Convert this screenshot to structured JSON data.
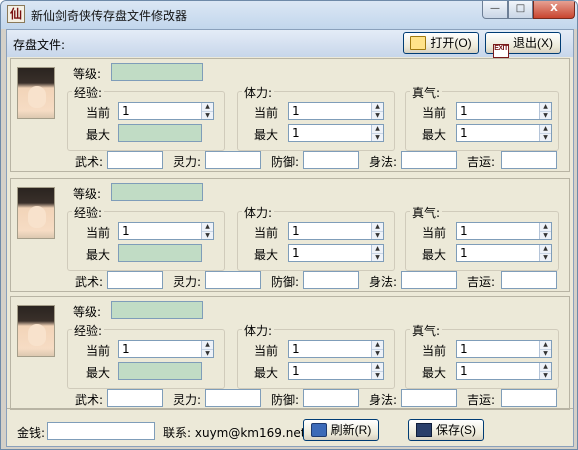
{
  "window": {
    "title": "新仙剑奇侠传存盘文件修改器",
    "icon_text": "仙",
    "min_glyph": "—",
    "max_glyph": "□",
    "close_glyph": "X"
  },
  "toolbar": {
    "save_file_label": "存盘文件:",
    "open_label": "打开(O)",
    "exit_label": "退出(X)",
    "exit_icon_text": "EXIT"
  },
  "labels": {
    "level": "等级:",
    "exp": "经验:",
    "hp": "体力:",
    "mp": "真气:",
    "current": "当前",
    "max": "最大",
    "wushu": "武术:",
    "lingli": "灵力:",
    "fangyu": "防御:",
    "shenfa": "身法:",
    "jiyun": "吉运:",
    "spin_up": "▲",
    "spin_down": "▼"
  },
  "characters": [
    {
      "portrait": "li-xiaoyao-portrait",
      "level": "",
      "exp_current": "1",
      "exp_max": "",
      "hp_current": "1",
      "hp_max": "1",
      "mp_current": "1",
      "mp_max": "1",
      "wushu": "",
      "lingli": "",
      "fangyu": "",
      "shenfa": "",
      "jiyun": ""
    },
    {
      "portrait": "zhao-linger-portrait",
      "level": "",
      "exp_current": "1",
      "exp_max": "",
      "hp_current": "1",
      "hp_max": "1",
      "mp_current": "1",
      "mp_max": "1",
      "wushu": "",
      "lingli": "",
      "fangyu": "",
      "shenfa": "",
      "jiyun": ""
    },
    {
      "portrait": "lin-yueru-portrait",
      "level": "",
      "exp_current": "1",
      "exp_max": "",
      "hp_current": "1",
      "hp_max": "1",
      "mp_current": "1",
      "mp_max": "1",
      "wushu": "",
      "lingli": "",
      "fangyu": "",
      "shenfa": "",
      "jiyun": ""
    }
  ],
  "footer": {
    "money_label": "金钱:",
    "money_value": "",
    "contact": "联系: xuym@km169.net",
    "refresh_label": "刷新(R)",
    "save_label": "保存(S)"
  }
}
